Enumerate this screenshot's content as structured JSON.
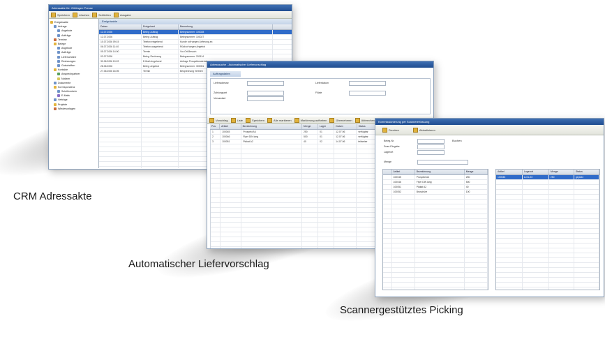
{
  "captions": {
    "crm": "CRM Adressakte",
    "liefer": "Automatischer Liefervorschlag",
    "picking": "Scannergestütztes Picking"
  },
  "win1": {
    "title": "Adressakte für: Göttingen Presse",
    "toolbar": [
      "Speichern",
      "Löschen",
      "Schließen",
      "Ausgabe"
    ],
    "panel_header": "Ereignisakte",
    "tree": [
      {
        "label": "Ereignisakte",
        "icon": "folder-icon",
        "indent": 0
      },
      {
        "label": "Anfrage",
        "icon": "doc-icon",
        "indent": 1
      },
      {
        "label": "Angebote",
        "icon": "doc-icon",
        "indent": 2
      },
      {
        "label": "Aufträge",
        "icon": "doc-icon",
        "indent": 2
      },
      {
        "label": "Termine",
        "icon": "calendar-icon",
        "indent": 1
      },
      {
        "label": "Belege",
        "icon": "folder-icon",
        "indent": 1
      },
      {
        "label": "Angebote",
        "icon": "doc-icon",
        "indent": 2
      },
      {
        "label": "Aufträge",
        "icon": "doc-icon",
        "indent": 2
      },
      {
        "label": "Lieferscheine",
        "icon": "doc-icon",
        "indent": 2
      },
      {
        "label": "Rechnungen",
        "icon": "doc-icon",
        "indent": 2
      },
      {
        "label": "Gutschriften",
        "icon": "doc-icon",
        "indent": 2
      },
      {
        "label": "Kontakte",
        "icon": "folder-icon",
        "indent": 1
      },
      {
        "label": "Ansprechpartner",
        "icon": "person-icon",
        "indent": 2
      },
      {
        "label": "Notizen",
        "icon": "note-icon",
        "indent": 2
      },
      {
        "label": "Dokumente",
        "icon": "doc-icon",
        "indent": 1
      },
      {
        "label": "Korrespondenz",
        "icon": "folder-icon",
        "indent": 1
      },
      {
        "label": "Schriftverkehr",
        "icon": "doc-icon",
        "indent": 2
      },
      {
        "label": "E-Mails",
        "icon": "mail-icon",
        "indent": 2
      },
      {
        "label": "Verträge",
        "icon": "doc-icon",
        "indent": 1
      },
      {
        "label": "Projekte",
        "icon": "folder-icon",
        "indent": 1
      },
      {
        "label": "Wiedervorlagen",
        "icon": "calendar-icon",
        "indent": 1
      }
    ],
    "columns": [
      "Datum",
      "Ereignisart",
      "Bemerkung"
    ],
    "rows": [
      [
        "12.07.2006",
        "Beleg: Auftrag",
        "Belegnummer: 100028"
      ],
      [
        "12.07.2006",
        "Beleg: Auftrag",
        "Belegnummer: 100027"
      ],
      [
        "10.07.2006 09:15",
        "Telefon eingehend",
        "Kunde ruft wegen Lieferung an"
      ],
      [
        "06.07.2006 11:40",
        "Telefon ausgehend",
        "Rückruf wegen Angebot"
      ],
      [
        "05.07.2006 14:00",
        "Termin",
        "Vor-Ort-Besuch"
      ],
      [
        "03.07.2006",
        "Beleg: Rechnung",
        "Belegnummer: 200114"
      ],
      [
        "30.06.2006 10:22",
        "E-Mail eingehend",
        "Anfrage Prospektmaterial"
      ],
      [
        "28.06.2006",
        "Beleg: Angebot",
        "Belegnummer: 300051"
      ],
      [
        "27.06.2006 16:05",
        "Termin",
        "Besprechung Vertrieb"
      ]
    ]
  },
  "win2": {
    "title": "Adresssuche - Automatischer Liefervorschlag",
    "tab": "Auftragsdaten",
    "fields": [
      "Lieferadresse",
      "Zahlungsart",
      "Versandart",
      "Lieferdatum",
      "Filiale"
    ],
    "toolbar": [
      "Vorschlag",
      "Liste",
      "Speichern",
      "Alle markieren",
      "Markierung aufheben",
      "Übernehmen",
      "Abbrechen"
    ],
    "columns": [
      "Pos",
      "Artikel",
      "Bezeichnung",
      "Menge",
      "Lager",
      "Datum",
      "Status"
    ],
    "rows": [
      [
        "1",
        "100045",
        "Prospekt A4",
        "250",
        "01",
        "12.07.06",
        "verfügbar"
      ],
      [
        "2",
        "100046",
        "Flyer DIN lang",
        "500",
        "01",
        "12.07.06",
        "verfügbar"
      ],
      [
        "3",
        "100051",
        "Plakat A2",
        "40",
        "02",
        "14.07.06",
        "teilweise"
      ]
    ]
  },
  "win3": {
    "title": "Kommissionierung per Scannererfassung",
    "toolbar": [
      "Drucken",
      "Aktualisieren"
    ],
    "labels": [
      "Beleg-Nr.",
      "Scan-Eingabe",
      "Lagerort",
      "Menge"
    ],
    "button": "Buchen",
    "left_columns": [
      "",
      "Artikel",
      "Bezeichnung",
      "Menge"
    ],
    "left_rows": [
      [
        "",
        "100045",
        "Prospekt A4",
        "250"
      ],
      [
        "",
        "100046",
        "Flyer DIN lang",
        "500"
      ],
      [
        "",
        "100051",
        "Plakat A2",
        "40"
      ],
      [
        "",
        "100052",
        "Broschüre",
        "100"
      ]
    ],
    "right_columns": [
      "Artikel",
      "Lagerort",
      "Menge",
      "Status"
    ],
    "right_rows": [
      [
        "100045",
        "A-01-03",
        "250",
        "gepickt"
      ]
    ]
  }
}
